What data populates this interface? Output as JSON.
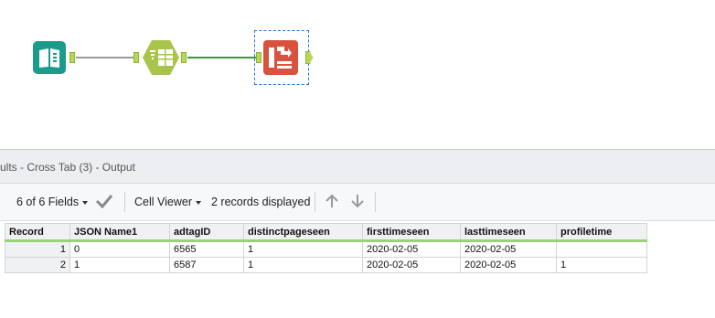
{
  "results": {
    "title": "ults - Cross Tab (3) - Output"
  },
  "toolbar": {
    "fields_label": "6 of 6 Fields",
    "dropdown_icon": "caret-down-icon",
    "check_icon": "checkmark-icon",
    "viewer_label": "Cell Viewer",
    "records_label": "2 records displayed",
    "up_icon": "arrow-up-icon",
    "down_icon": "arrow-down-icon"
  },
  "grid": {
    "columns": [
      "Record",
      "JSON Name1",
      "adtagID",
      "distinctpageseen",
      "firsttimeseen",
      "lasttimeseen",
      "profiletime"
    ],
    "rows": [
      [
        "1",
        "0",
        "6565",
        "1",
        "2020-02-05",
        "2020-02-05",
        ""
      ],
      [
        "2",
        "1",
        "6587",
        "1",
        "2020-02-05",
        "2020-02-05",
        "1"
      ]
    ]
  },
  "colors": {
    "input_tool": "#1a9b8c",
    "select_tool": "#a9c44a",
    "crosstab_tool": "#d8523d",
    "connection": "#3d9a3a",
    "header_underline": "#9ad27a"
  }
}
